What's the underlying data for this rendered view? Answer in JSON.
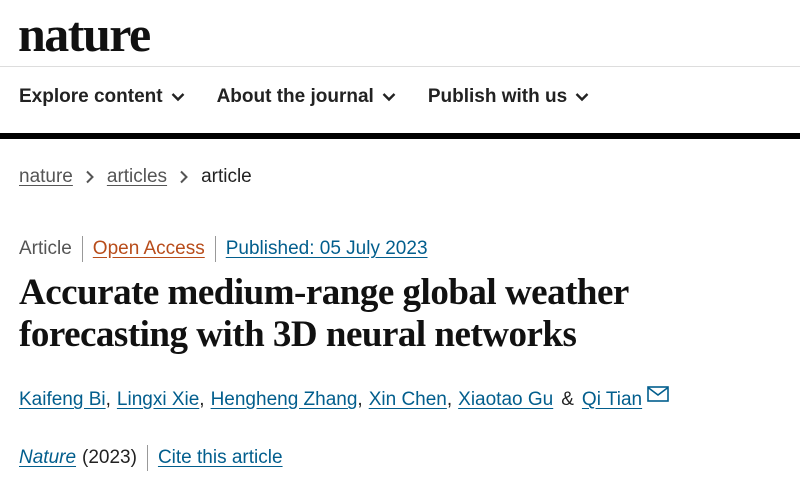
{
  "header": {
    "logo": "nature"
  },
  "nav": {
    "items": [
      {
        "label": "Explore content"
      },
      {
        "label": "About the journal"
      },
      {
        "label": "Publish with us"
      }
    ]
  },
  "breadcrumb": {
    "home": "nature",
    "section": "articles",
    "current": "article"
  },
  "article": {
    "type": "Article",
    "access": "Open Access",
    "published": "Published: 05 July 2023",
    "title": "Accurate medium-range global weather forecasting with 3D neural networks",
    "authors": [
      "Kaifeng Bi",
      "Lingxi Xie",
      "Hengheng Zhang",
      "Xin Chen",
      "Xiaotao Gu",
      "Qi Tian"
    ],
    "author_separator": ",",
    "last_separator": "&",
    "journal": "Nature",
    "year": "(2023)",
    "cite_label": "Cite this article"
  },
  "colors": {
    "link": "#025e8d",
    "open_access": "#b84c1a",
    "rule": "#000000"
  },
  "icons": {
    "nav_dropdown": "chevron-down-icon",
    "breadcrumb_sep": "chevron-right-icon",
    "contact": "mail-icon"
  }
}
